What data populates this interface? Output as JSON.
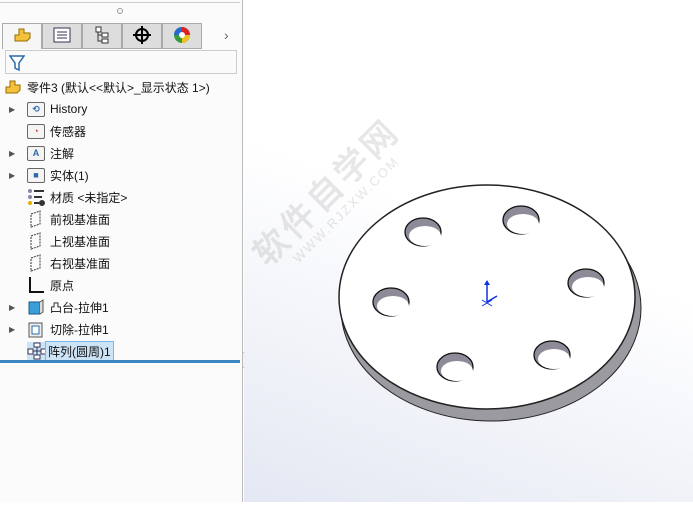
{
  "panel": {
    "tabs": [
      {
        "icon": "feature-manager-icon",
        "active": true
      },
      {
        "icon": "property-manager-icon"
      },
      {
        "icon": "configuration-manager-icon"
      },
      {
        "icon": "dimxpert-icon"
      },
      {
        "icon": "display-manager-icon"
      }
    ],
    "more_tabs": "›",
    "filter_icon": "filter-icon",
    "root": "零件3  (默认<<默认>_显示状态 1>)",
    "tree": [
      {
        "label": "History",
        "icon": "history-folder-icon",
        "expand": true
      },
      {
        "label": "传感器",
        "icon": "sensor-folder-icon",
        "expand": false
      },
      {
        "label": "注解",
        "icon": "annotation-folder-icon",
        "expand": true
      },
      {
        "label": "实体(1)",
        "icon": "solid-bodies-folder-icon",
        "expand": true
      },
      {
        "label": "材质 <未指定>",
        "icon": "material-icon",
        "expand": false
      },
      {
        "label": "前视基准面",
        "icon": "plane-icon",
        "expand": false
      },
      {
        "label": "上视基准面",
        "icon": "plane-icon",
        "expand": false
      },
      {
        "label": "右视基准面",
        "icon": "plane-icon",
        "expand": false
      },
      {
        "label": "原点",
        "icon": "origin-icon",
        "expand": false
      },
      {
        "label": "凸台-拉伸1",
        "icon": "boss-extrude-icon",
        "expand": true
      },
      {
        "label": "切除-拉伸1",
        "icon": "cut-extrude-icon",
        "expand": true
      },
      {
        "label": "阵列(圆周)1",
        "icon": "circular-pattern-icon",
        "expand": false,
        "selected": true
      }
    ]
  },
  "watermark": {
    "text": "软件自学网",
    "url": "WWW.RJZXW.COM"
  },
  "colors": {
    "selection": "#cde4f7",
    "accent": "#3c86c4"
  }
}
